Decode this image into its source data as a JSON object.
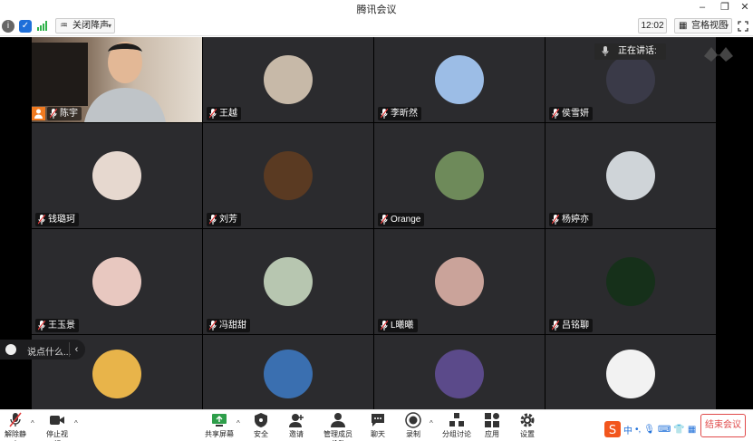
{
  "window": {
    "title": "腾讯会议"
  },
  "toolbar": {
    "noise_label": "关闭降声",
    "clock": "12:02",
    "view_label": "宫格视图"
  },
  "speaking_label": "正在讲话:",
  "participants": [
    {
      "name": "陈宇",
      "avatar_color": "#8a7a6a"
    },
    {
      "name": "王越",
      "avatar_color": "#c7b9a8"
    },
    {
      "name": "李昕然",
      "avatar_color": "#9cbde6"
    },
    {
      "name": "侯雪妍",
      "avatar_color": "#3a3a48"
    },
    {
      "name": "钱璐珂",
      "avatar_color": "#e6d8cf"
    },
    {
      "name": "刘芳",
      "avatar_color": "#5a3a22"
    },
    {
      "name": "Orange",
      "avatar_color": "#6e8a5a"
    },
    {
      "name": "杨婷亦",
      "avatar_color": "#cfd4d8"
    },
    {
      "name": "王玉景",
      "avatar_color": "#e8c8c0"
    },
    {
      "name": "冯甜甜",
      "avatar_color": "#b7c6b0"
    },
    {
      "name": "L曦曦",
      "avatar_color": "#caa39a"
    },
    {
      "name": "吕铭聊",
      "avatar_color": "#16301a"
    },
    {
      "name": "",
      "avatar_color": "#e8b44a"
    },
    {
      "name": "",
      "avatar_color": "#3a6fb0"
    },
    {
      "name": "",
      "avatar_color": "#5b4a8a"
    },
    {
      "name": "",
      "avatar_color": "#f2f2f2"
    }
  ],
  "chat": {
    "placeholder": "说点什么..."
  },
  "bottombar": {
    "unmute": "解除静音",
    "stop_video": "停止视频",
    "share": "共享屏幕",
    "security": "安全",
    "invite": "邀请",
    "members": "管理成员(16)",
    "chat": "聊天",
    "record": "录制",
    "breakout": "分组讨论",
    "apps": "应用",
    "settings": "设置",
    "end": "结束会议"
  },
  "ime": {
    "lang": "中"
  }
}
